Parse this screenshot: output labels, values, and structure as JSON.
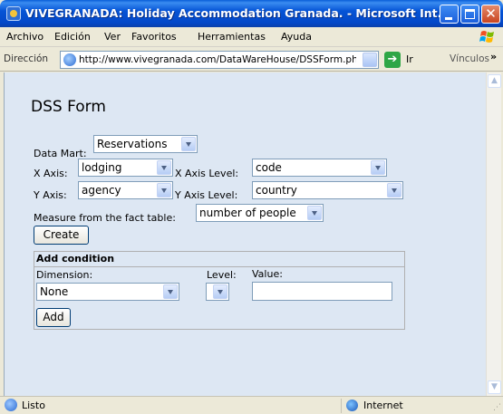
{
  "window": {
    "title": "VIVEGRANADA: Holiday Accommodation Granada. - Microsoft Int..."
  },
  "menu": [
    "Archivo",
    "Edición",
    "Ver",
    "Favoritos",
    "Herramientas",
    "Ayuda"
  ],
  "address": {
    "label": "Dirección",
    "url": "http://www.vivegranada.com/DataWareHouse/DSSForm.ph",
    "go_label": "Ir",
    "links_label": "Vínculos",
    "more_glyph": "»"
  },
  "form": {
    "title": "DSS Form",
    "data_mart": {
      "label": "Data Mart:",
      "value": "Reservations"
    },
    "x_axis": {
      "label": "X Axis:",
      "value": "lodging"
    },
    "x_axis_level": {
      "label": "X Axis Level:",
      "value": "code"
    },
    "y_axis": {
      "label": "Y Axis:",
      "value": "agency"
    },
    "y_axis_level": {
      "label": "Y Axis Level:",
      "value": "country"
    },
    "measure": {
      "label": "Measure from the fact table:",
      "value": "number of people"
    },
    "create_label": "Create"
  },
  "condition": {
    "header": "Add condition",
    "dimension_label": "Dimension:",
    "dimension_value": "None",
    "level_label": "Level:",
    "level_value": "",
    "value_label": "Value:",
    "value_input": "",
    "add_label": "Add"
  },
  "status": {
    "text": "Listo",
    "zone": "Internet"
  }
}
